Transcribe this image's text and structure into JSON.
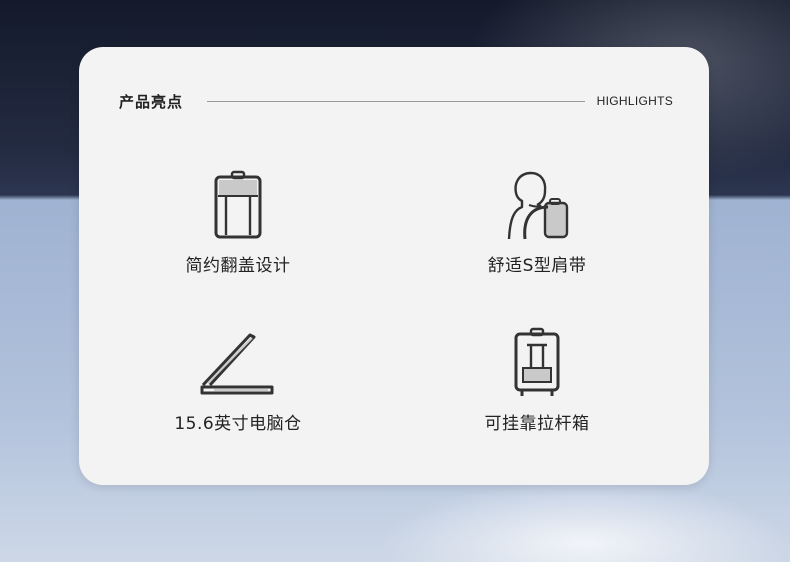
{
  "header": {
    "title_cn": "产品亮点",
    "title_en": "HIGHLIGHTS"
  },
  "features": [
    {
      "label": "简约翻盖设计",
      "icon": "flip-lid-bag-icon"
    },
    {
      "label": "舒适S型肩带",
      "icon": "s-shaped-strap-icon"
    },
    {
      "label": "15.6英寸电脑仓",
      "icon": "laptop-icon"
    },
    {
      "label": "可挂靠拉杆箱",
      "icon": "luggage-trolley-icon"
    }
  ],
  "colors": {
    "card_bg": "#f3f3f3",
    "icon_stroke": "#333333",
    "icon_fill": "#c9c9c9",
    "text": "#222222"
  }
}
